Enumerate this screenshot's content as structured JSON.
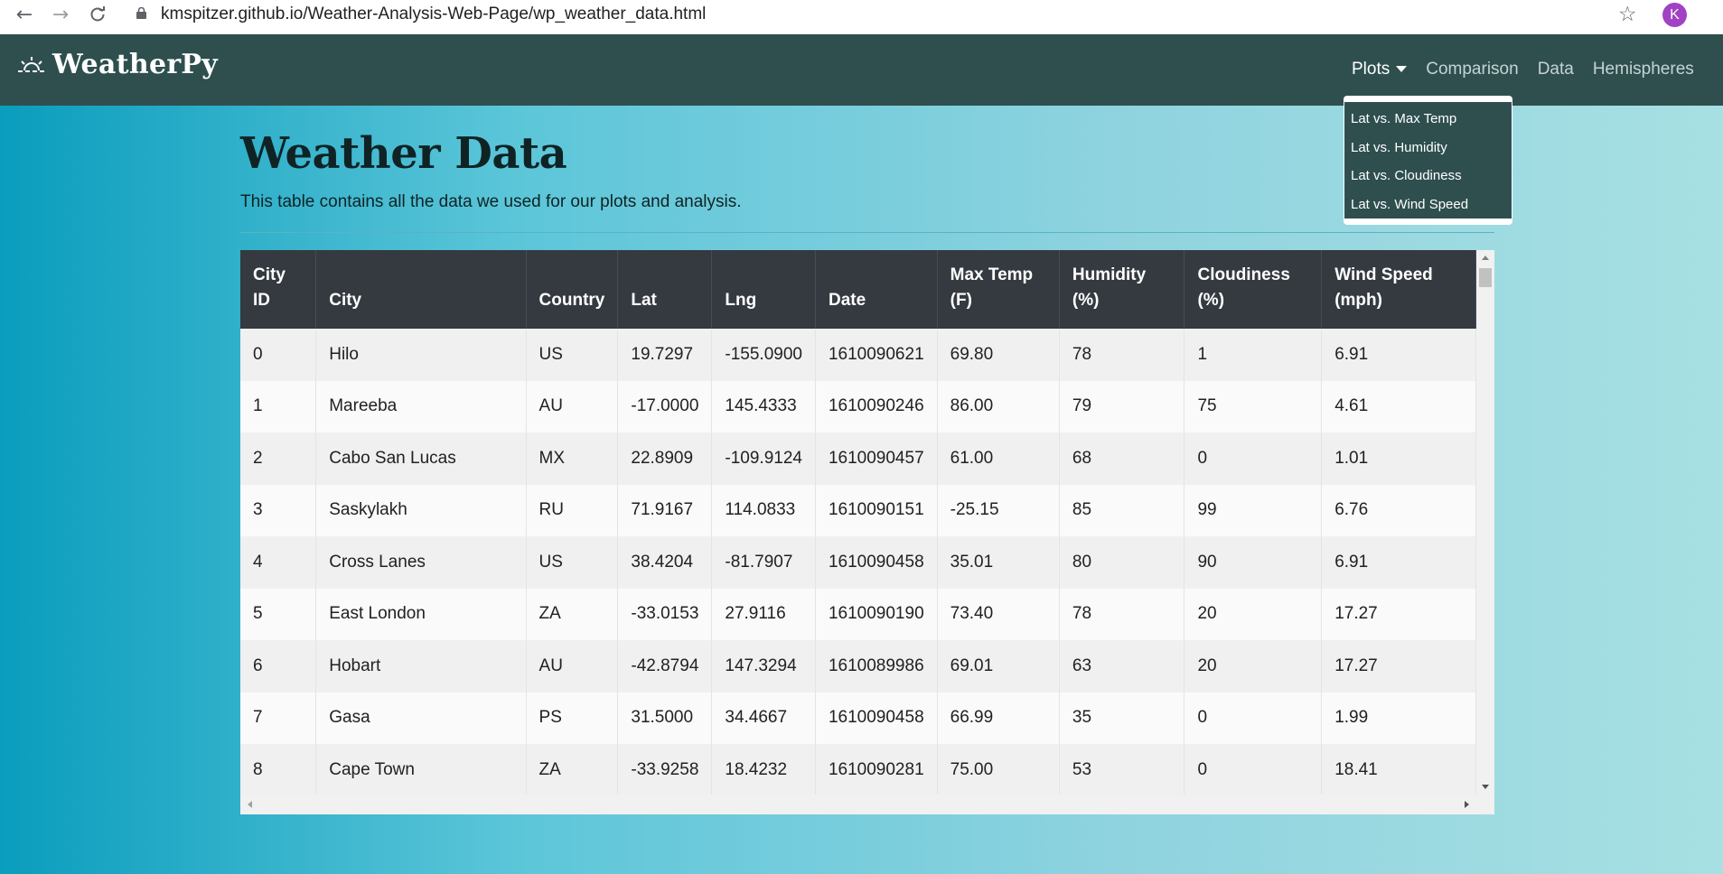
{
  "browser": {
    "back_icon": "back-arrow-icon",
    "forward_icon": "forward-arrow-icon",
    "reload_icon": "reload-icon",
    "url": "kmspitzer.github.io/Weather-Analysis-Web-Page/wp_weather_data.html",
    "profile_initial": "K"
  },
  "navbar": {
    "brand": "WeatherPy",
    "links": [
      "Plots",
      "Comparison",
      "Data",
      "Hemispheres"
    ],
    "dropdown": [
      "Lat vs. Max Temp",
      "Lat vs. Humidity",
      "Lat vs. Cloudiness",
      "Lat vs. Wind Speed"
    ]
  },
  "page": {
    "title": "Weather Data",
    "lead": "This table contains all the data we used for our plots and analysis."
  },
  "table": {
    "headers": [
      [
        "City",
        "ID"
      ],
      [
        "City"
      ],
      [
        "Country"
      ],
      [
        "Lat"
      ],
      [
        "Lng"
      ],
      [
        "Date"
      ],
      [
        "Max Temp",
        "(F)"
      ],
      [
        "Humidity",
        "(%)"
      ],
      [
        "Cloudiness",
        "(%)"
      ],
      [
        "Wind Speed",
        "(mph)"
      ]
    ],
    "rows": [
      [
        "0",
        "Hilo",
        "US",
        "19.7297",
        "-155.0900",
        "1610090621",
        "69.80",
        "78",
        "1",
        "6.91"
      ],
      [
        "1",
        "Mareeba",
        "AU",
        "-17.0000",
        "145.4333",
        "1610090246",
        "86.00",
        "79",
        "75",
        "4.61"
      ],
      [
        "2",
        "Cabo San Lucas",
        "MX",
        "22.8909",
        "-109.9124",
        "1610090457",
        "61.00",
        "68",
        "0",
        "1.01"
      ],
      [
        "3",
        "Saskylakh",
        "RU",
        "71.9167",
        "114.0833",
        "1610090151",
        "-25.15",
        "85",
        "99",
        "6.76"
      ],
      [
        "4",
        "Cross Lanes",
        "US",
        "38.4204",
        "-81.7907",
        "1610090458",
        "35.01",
        "80",
        "90",
        "6.91"
      ],
      [
        "5",
        "East London",
        "ZA",
        "-33.0153",
        "27.9116",
        "1610090190",
        "73.40",
        "78",
        "20",
        "17.27"
      ],
      [
        "6",
        "Hobart",
        "AU",
        "-42.8794",
        "147.3294",
        "1610089986",
        "69.01",
        "63",
        "20",
        "17.27"
      ],
      [
        "7",
        "Gasa",
        "PS",
        "31.5000",
        "34.4667",
        "1610090458",
        "66.99",
        "35",
        "0",
        "1.99"
      ],
      [
        "8",
        "Cape Town",
        "ZA",
        "-33.9258",
        "18.4232",
        "1610090281",
        "75.00",
        "53",
        "0",
        "18.41"
      ]
    ]
  }
}
